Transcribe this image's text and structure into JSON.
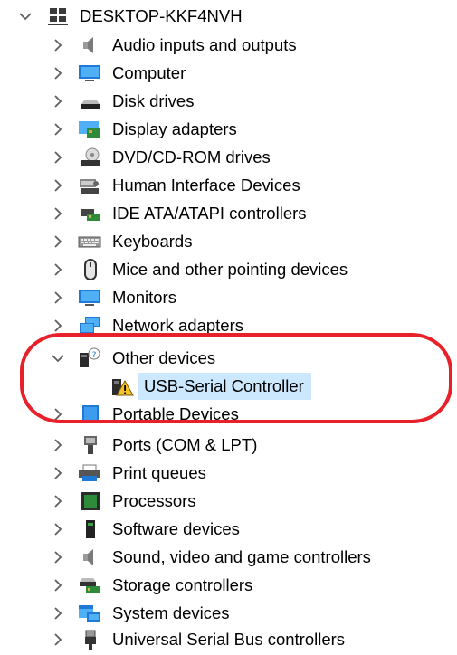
{
  "root": {
    "label": "DESKTOP-KKF4NVH",
    "icon": "computer-network-icon",
    "expanded": true
  },
  "categories": [
    {
      "id": "audio",
      "label": "Audio inputs and outputs",
      "icon": "speaker-icon",
      "expanded": false
    },
    {
      "id": "computer",
      "label": "Computer",
      "icon": "monitor-icon",
      "expanded": false
    },
    {
      "id": "disk",
      "label": "Disk drives",
      "icon": "disk-drive-icon",
      "expanded": false
    },
    {
      "id": "display",
      "label": "Display adapters",
      "icon": "display-adapter-icon",
      "expanded": false
    },
    {
      "id": "dvd",
      "label": "DVD/CD-ROM drives",
      "icon": "optical-drive-icon",
      "expanded": false
    },
    {
      "id": "hid",
      "label": "Human Interface Devices",
      "icon": "hid-icon",
      "expanded": false
    },
    {
      "id": "ide",
      "label": "IDE ATA/ATAPI controllers",
      "icon": "ide-controller-icon",
      "expanded": false
    },
    {
      "id": "keyboards",
      "label": "Keyboards",
      "icon": "keyboard-icon",
      "expanded": false
    },
    {
      "id": "mice",
      "label": "Mice and other pointing devices",
      "icon": "mouse-icon",
      "expanded": false
    },
    {
      "id": "monitors",
      "label": "Monitors",
      "icon": "monitor-icon",
      "expanded": false
    },
    {
      "id": "network",
      "label": "Network adapters",
      "icon": "network-adapter-icon",
      "expanded": false
    },
    {
      "id": "other",
      "label": "Other devices",
      "icon": "unknown-device-icon",
      "expanded": true,
      "children": [
        {
          "label": "USB-Serial Controller",
          "icon": "warning-device-icon",
          "selected": true
        }
      ]
    },
    {
      "id": "portable",
      "label": "Portable Devices",
      "icon": "portable-device-icon",
      "expanded": false
    },
    {
      "id": "ports",
      "label": "Ports (COM & LPT)",
      "icon": "port-icon",
      "expanded": false
    },
    {
      "id": "print",
      "label": "Print queues",
      "icon": "printer-icon",
      "expanded": false
    },
    {
      "id": "processors",
      "label": "Processors",
      "icon": "processor-icon",
      "expanded": false
    },
    {
      "id": "software",
      "label": "Software devices",
      "icon": "software-device-icon",
      "expanded": false
    },
    {
      "id": "sound",
      "label": "Sound, video and game controllers",
      "icon": "speaker-icon",
      "expanded": false
    },
    {
      "id": "storage",
      "label": "Storage controllers",
      "icon": "storage-controller-icon",
      "expanded": false
    },
    {
      "id": "system",
      "label": "System devices",
      "icon": "system-device-icon",
      "expanded": false
    },
    {
      "id": "usb",
      "label": "Universal Serial Bus controllers",
      "icon": "usb-plug-icon",
      "expanded": false
    }
  ],
  "colors": {
    "selection": "#cce8ff",
    "annotation": "#e8202a",
    "chevron": "#5f5f5f"
  }
}
